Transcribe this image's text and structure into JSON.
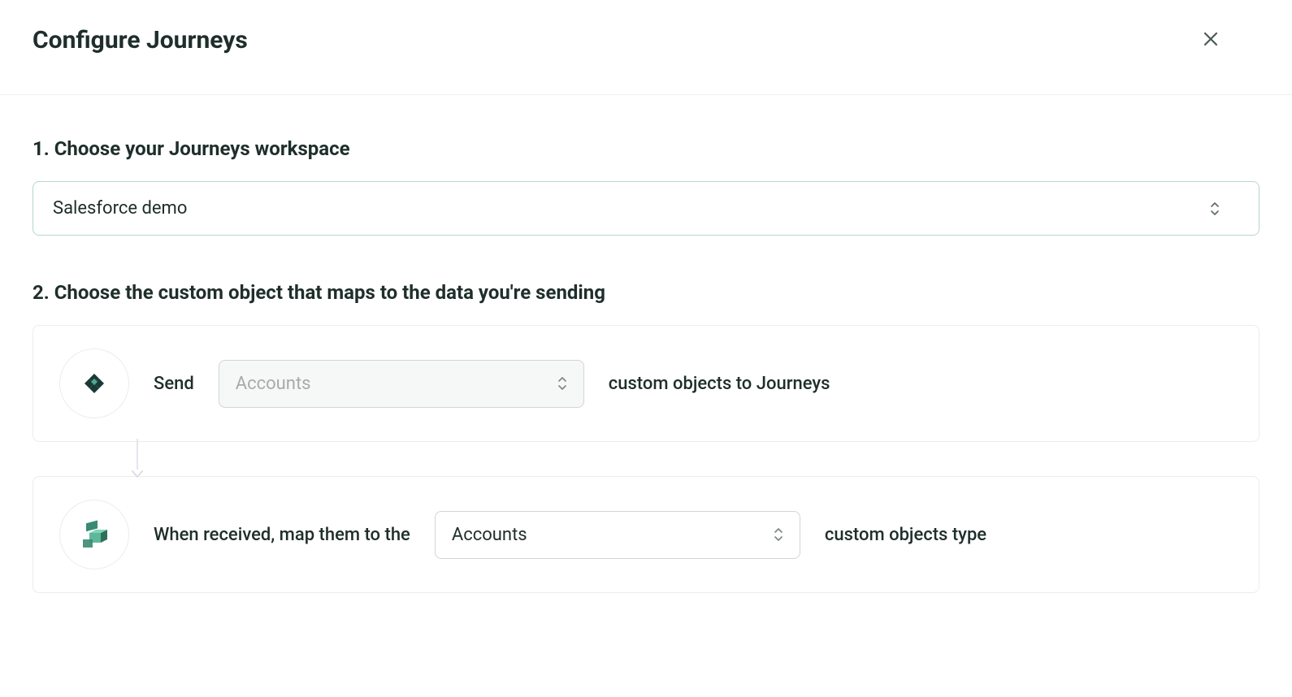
{
  "header": {
    "title": "Configure Journeys"
  },
  "section1": {
    "heading": "1. Choose your Journeys workspace",
    "workspace_selected": "Salesforce demo"
  },
  "section2": {
    "heading": "2. Choose the custom object that maps to the data you're sending",
    "send_row": {
      "prefix": "Send",
      "object_placeholder": "Accounts",
      "suffix": "custom objects to Journeys"
    },
    "receive_row": {
      "prefix": "When received, map them to the",
      "object_selected": "Accounts",
      "suffix": "custom objects type"
    }
  }
}
